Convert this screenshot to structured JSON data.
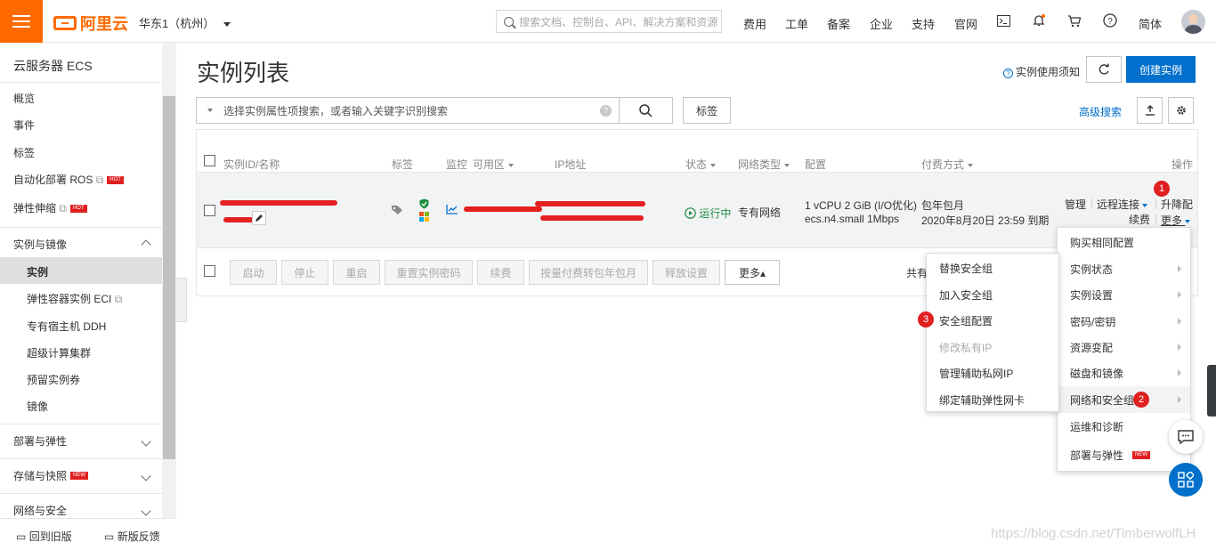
{
  "topbar": {
    "logo": "阿里云",
    "region": "华东1（杭州）",
    "search_placeholder": "搜索文档、控制台、API、解决方案和资源",
    "nav": [
      "费用",
      "工单",
      "备案",
      "企业",
      "支持",
      "官网"
    ],
    "lang": "简体"
  },
  "sidebar": {
    "title": "云服务器 ECS",
    "items": [
      "概览",
      "事件",
      "标签",
      "自动化部署 ROS",
      "弹性伸缩"
    ],
    "hot": "HOT",
    "new": "NEW",
    "section_instances": "实例与镜像",
    "sub_items": [
      "实例",
      "弹性容器实例 ECI",
      "专有宿主机 DDH",
      "超级计算集群",
      "预留实例券",
      "镜像"
    ],
    "sections": [
      "部署与弹性",
      "存储与快照",
      "网络与安全"
    ],
    "footer": [
      "回到旧版",
      "新版反馈"
    ]
  },
  "main": {
    "title": "实例列表",
    "notice": "实例使用须知",
    "create_button": "创建实例",
    "filter_placeholder": "选择实例属性项搜索，或者输入关键字识别搜索",
    "tag_button": "标签",
    "advanced_search": "高级搜索"
  },
  "table": {
    "headers": [
      "实例ID/名称",
      "标签",
      "监控",
      "可用区",
      "IP地址",
      "状态",
      "网络类型",
      "配置",
      "付费方式",
      "操作"
    ],
    "row": {
      "status": "运行中",
      "network": "专有网络",
      "config_line1": "1 vCPU 2 GiB (I/O优化)",
      "config_type": "ecs.n4.small",
      "bandwidth": "1Mbps",
      "billing_line1": "包年包月",
      "billing_line2": "2020年8月20日 23:59 到期",
      "actions": [
        "管理",
        "远程连接",
        "升降配",
        "续费",
        "更多"
      ]
    },
    "footer_buttons": [
      "启动",
      "停止",
      "重启",
      "重置实例密码",
      "续费",
      "按量付费转包年包月",
      "释放设置",
      "更多▴"
    ],
    "footer_total": "共有"
  },
  "more_menu": {
    "items": [
      "购买相同配置",
      "实例状态",
      "实例设置",
      "密码/密钥",
      "资源变配",
      "磁盘和镜像",
      "网络和安全组",
      "运维和诊断",
      "部署与弹性"
    ],
    "new_badge": "NEW"
  },
  "sub_menu": {
    "items": [
      "替换安全组",
      "加入安全组",
      "安全组配置",
      "修改私有IP",
      "管理辅助私网IP",
      "绑定辅助弹性网卡"
    ]
  },
  "badges": [
    "1",
    "2",
    "3"
  ],
  "watermark": "https://blog.csdn.net/TimberwolfLH",
  "colors": {
    "accent": "#ff6a00",
    "primary": "#0070cc",
    "danger": "#e02020",
    "running": "#1e8e3e"
  }
}
